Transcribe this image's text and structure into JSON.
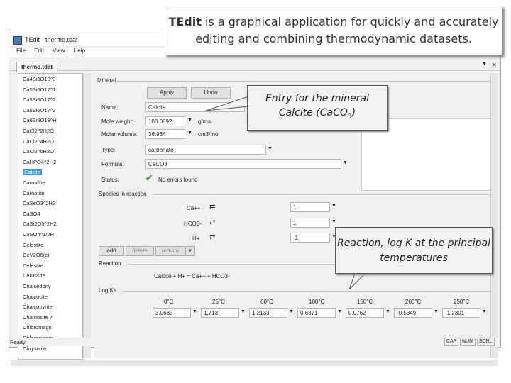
{
  "window": {
    "title": "TEdit - thermo.tdat",
    "menu": [
      "File",
      "Edit",
      "View",
      "Help"
    ],
    "tab": "thermo.tdat"
  },
  "callouts": {
    "title_bold": "TEdit",
    "title_text": " is a graphical application for quickly and accurately editing and combining thermodynamic datasets.",
    "entry": "Entry for the mineral Calcite (CaCO",
    "entry_sub": "3",
    "entry_end": ")",
    "reaction": "Reaction, log K at the principal temperatures"
  },
  "tree": {
    "items": [
      "Ca4Si3O10^3",
      "Ca5Si6O17^1",
      "Ca5Si6O17^2",
      "Ca5Si6O17^3",
      "Ca6Si6O18^H",
      "CaCl2^2H2O",
      "CaCl2^4H2O",
      "CaCl2^6H2O",
      "CaHPO4^2H2",
      "Calcite",
      "Carnallite",
      "Carnotite",
      "CaSeO3^2H2",
      "CaSO4",
      "CaSi2O5^2H2",
      "CaSO4^1/2H",
      "Celestite",
      "CeV2O6(c)",
      "Celestite",
      "Cerussite",
      "Chalcedony",
      "Chalcocite",
      "Chalcopyrite",
      "Chamosite 7",
      "Chloromagn",
      "Chloropyrom",
      "Chrysotile"
    ],
    "selected_index": 9
  },
  "mineral": {
    "group_label": "Mineral",
    "apply_label": "Apply",
    "undo_label": "Undo",
    "name_label": "Name:",
    "name_value": "Calcite",
    "mole_weight_label": "Mole weight:",
    "mole_weight_value": "100.0892",
    "mole_weight_unit": "g/mol",
    "molar_volume_label": "Molar volume:",
    "molar_volume_value": "36.934",
    "molar_volume_unit": "cm3/mol",
    "type_label": "Type:",
    "type_value": "carbonate",
    "formula_label": "Formula:",
    "formula_value": "CaCO3",
    "status_label": "Status:",
    "status_value": "No errors found"
  },
  "species": {
    "group_label": "Species in reaction",
    "rows": [
      {
        "name": "Ca++",
        "coef": "1"
      },
      {
        "name": "HCO3-",
        "coef": "1"
      },
      {
        "name": "H+",
        "coef": "-1"
      }
    ],
    "add_label": "add",
    "delete_label": "delete",
    "reduce_label": "reduce"
  },
  "reaction": {
    "group_label": "Reaction",
    "text": "Calcite + H+ = Ca++ + HCO3-"
  },
  "logk": {
    "group_label": "Log Ks",
    "temps": [
      "0°C",
      "25°C",
      "60°C",
      "100°C",
      "150°C",
      "200°C",
      "250°C"
    ],
    "values": [
      "3.0683",
      "1.713",
      "1.2133",
      "0.6871",
      "0.0762",
      "-0.5349",
      "-1.2301"
    ]
  },
  "statusbar": {
    "ready": "Ready",
    "cap": "CAP",
    "num": "NUM",
    "scrl": "SCRL"
  },
  "colors": {
    "selection": "#3399ff",
    "ok_check": "#2e9e2e"
  },
  "icons": {
    "status": "check-icon",
    "swap": "swap-icon",
    "dropdown": "chevron-down-icon"
  }
}
